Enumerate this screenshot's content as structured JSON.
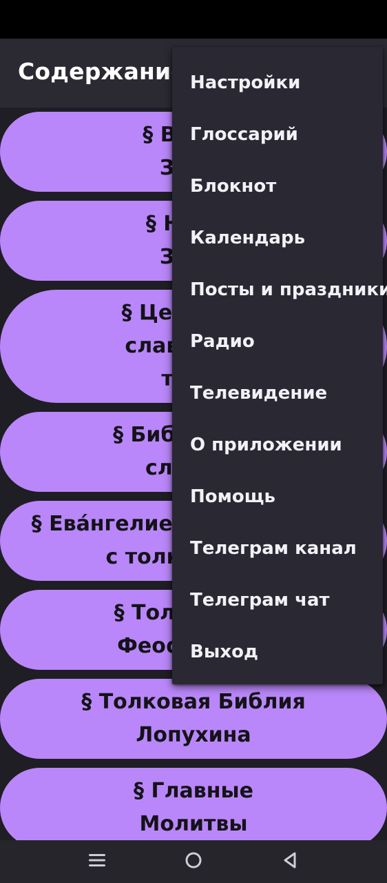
{
  "app_bar": {
    "title": "Содержание"
  },
  "list": [
    {
      "line1": "§ Ветхий",
      "line2": "Завет"
    },
    {
      "line1": "§ Новый",
      "line2": "Завет"
    },
    {
      "line1": "§ Церковно-",
      "line2": "славянский",
      "line3": "текст"
    },
    {
      "line1": "§ Библейский",
      "line2": "словарь"
    },
    {
      "line1": "§ Ева́нгелие с толкованием",
      "line2": "с толкованием"
    },
    {
      "line1": "§ Толкование",
      "line2": "Феофилакта"
    },
    {
      "line1": "§ Толковая Библия",
      "line2": "Лопухина"
    },
    {
      "line1": "§ Главные",
      "line2": "Молитвы"
    }
  ],
  "menu": {
    "items": [
      "Настройки",
      "Глоссарий",
      "Блокнот",
      "Календарь",
      "Посты и праздники",
      "Радио",
      "Телевидение",
      "О приложении",
      "Помощь",
      "Телеграм канал",
      "Телеграм чат",
      "Выход"
    ]
  },
  "nav": {
    "recents_icon": "menu-lines-icon",
    "home_icon": "circle-icon",
    "back_icon": "triangle-left-icon"
  },
  "colors": {
    "pill": "#b987f9",
    "menu_bg": "#2a2833",
    "app_bar": "#2b2a33",
    "background": "#1f1e24"
  }
}
